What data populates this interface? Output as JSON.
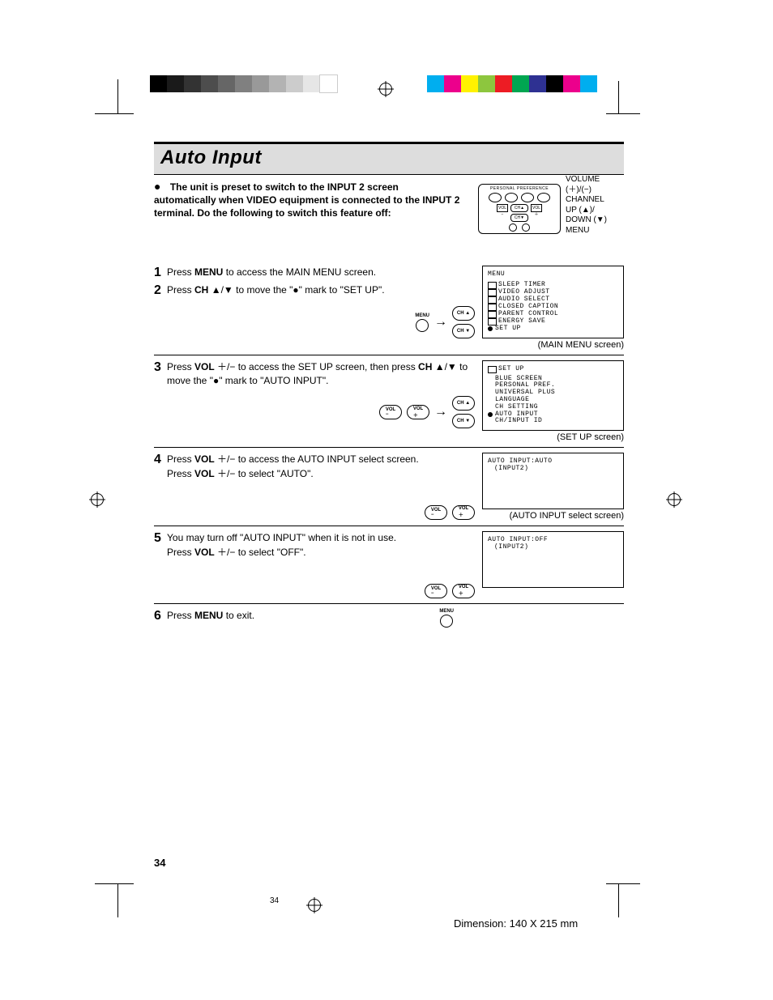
{
  "colorbars_left": [
    "#000000",
    "#1a1a1a",
    "#333333",
    "#4d4d4d",
    "#666666",
    "#808080",
    "#999999",
    "#b3b3b3",
    "#cccccc",
    "#e6e6e6",
    "#ffffff"
  ],
  "colorbars_right": [
    "#00aeef",
    "#ec008c",
    "#fff200",
    "#8dc63e",
    "#ed1c24",
    "#00a651",
    "#2e3192",
    "#000000",
    "#ec008c",
    "#00aeef"
  ],
  "title": "Auto Input",
  "intro": "The unit is preset to switch to the INPUT 2 screen automatically when VIDEO equipment is connected to the INPUT 2 terminal. Do the following to switch this feature off:",
  "remote": {
    "header": "PERSONAL PREFERENCE",
    "labels": {
      "volume": "VOLUME",
      "volsym": "(＋)/(−)",
      "channel": "CHANNEL",
      "up": "UP (▲)/",
      "down": "DOWN (▼)",
      "menu": "MENU"
    }
  },
  "btnlabels": {
    "menu": "MENU",
    "ch_up": "CH ▲",
    "ch_dn": "CH ▼",
    "vol_minus": "VOL\n−",
    "vol_plus": "VOL\n＋"
  },
  "steps": {
    "s1": {
      "num": "1",
      "parts": [
        "Press ",
        "MENU",
        " to access the MAIN MENU screen."
      ]
    },
    "s2": {
      "num": "2",
      "parts": [
        "Press ",
        "CH",
        " ▲/▼ to move the \"●\" mark to \"SET UP\"."
      ]
    },
    "s3": {
      "num": "3",
      "parts": [
        "Press ",
        "VOL",
        " ＋/− to access the SET UP screen, then press ",
        "CH",
        " ▲/▼ to move the \"●\" mark to \"AUTO INPUT\"."
      ]
    },
    "s4": {
      "num": "4",
      "line1_parts": [
        "Press ",
        "VOL",
        " ＋/− to access the AUTO INPUT select screen."
      ],
      "line2_parts": [
        "Press ",
        "VOL",
        " ＋/− to select \"AUTO\"."
      ]
    },
    "s5": {
      "num": "5",
      "line1": "You may turn off \"AUTO INPUT\" when it is not in use.",
      "line2_parts": [
        "Press ",
        "VOL",
        " ＋/− to select \"OFF\"."
      ]
    },
    "s6": {
      "num": "6",
      "parts": [
        "Press ",
        "MENU",
        " to exit."
      ]
    }
  },
  "screens": {
    "main": {
      "header": "MENU",
      "items": [
        "SLEEP TIMER",
        "VIDEO ADJUST",
        "AUDIO SELECT",
        "CLOSED CAPTION",
        "PARENT CONTROL",
        "ENERGY SAVE",
        "SET UP"
      ],
      "selected": "SET UP",
      "caption": "(MAIN MENU screen)"
    },
    "setup": {
      "header": "SET UP",
      "items": [
        "BLUE SCREEN",
        "PERSONAL PREF.",
        "UNIVERSAL PLUS",
        "LANGUAGE",
        "CH SETTING",
        "AUTO INPUT",
        "CH/INPUT ID"
      ],
      "selected": "AUTO INPUT",
      "caption": "(SET UP screen)"
    },
    "auto": {
      "text1": "AUTO INPUT:AUTO",
      "text2": "(INPUT2)",
      "caption": "(AUTO INPUT select screen)"
    },
    "off": {
      "text1": "AUTO INPUT:OFF",
      "text2": "(INPUT2)"
    }
  },
  "footer": {
    "page_print": "34",
    "page_small": "34",
    "dimension": "Dimension: 140  X 215 mm"
  }
}
